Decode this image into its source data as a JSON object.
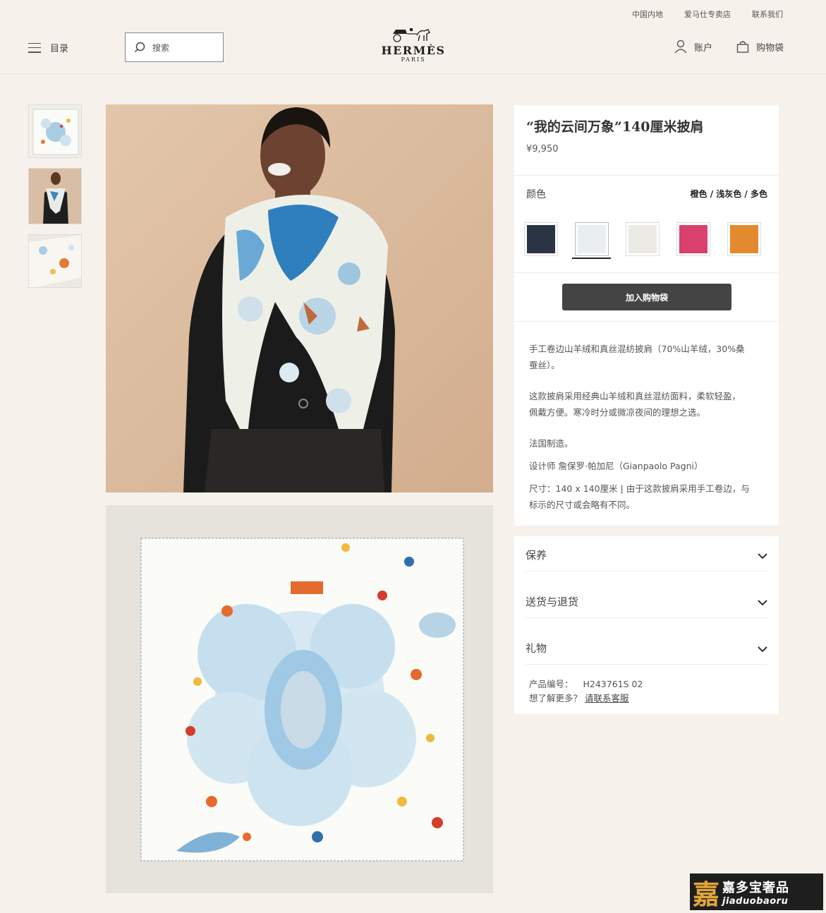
{
  "header": {
    "util_links": [
      "中国内地",
      "爱马仕专卖店",
      "联系我们"
    ],
    "menu_label": "目录",
    "search_placeholder": "搜索",
    "logo_word": "HERMÈS",
    "logo_sub": "PARIS",
    "account_label": "账户",
    "bag_label": "购物袋"
  },
  "product": {
    "title": "“我的云间万象”140厘米披肩",
    "price": "¥9,950",
    "color_label": "颜色",
    "color_value": "橙色 / 浅灰色 / 多色",
    "swatches": [
      {
        "name": "navy",
        "color": "#2a3445"
      },
      {
        "name": "cream-blue",
        "color": "#e9eef0",
        "selected": true
      },
      {
        "name": "light-grey",
        "color": "#eceae4"
      },
      {
        "name": "pink",
        "color": "#d9406e"
      },
      {
        "name": "orange",
        "color": "#e38a2e"
      }
    ],
    "add_to_bag": "加入购物袋",
    "desc_lines": [
      "手工卷边山羊绒和真丝混纺披肩（70%山羊绒，30%桑",
      "蚕丝）。",
      "这款披肩采用经典山羊绒和真丝混纺面料，柔软轻盈，",
      "佩戴方便。寒冷时分或微凉夜间的理想之选。",
      "法国制造。",
      "设计师 詹保罗·帕加尼（Gianpaolo Pagni）",
      "尺寸：140 x 140厘米 | 由于这款披肩采用手工卷边，与",
      "标示的尺寸或会略有不同。"
    ]
  },
  "accordion": {
    "items": [
      "保养",
      "送货与退货",
      "礼物"
    ],
    "sku_label": "产品编号：",
    "sku_value": "H243761S 02",
    "help_text": "想了解更多？",
    "help_link": "请联系客服"
  },
  "watermark": {
    "glyph": "嘉",
    "cn": "嘉多宝奢品",
    "en": "jiaduobaoru"
  },
  "colors": {
    "background": "#f6f1eb",
    "button": "#444444",
    "photo_backdrop": "#dcbb9c"
  }
}
